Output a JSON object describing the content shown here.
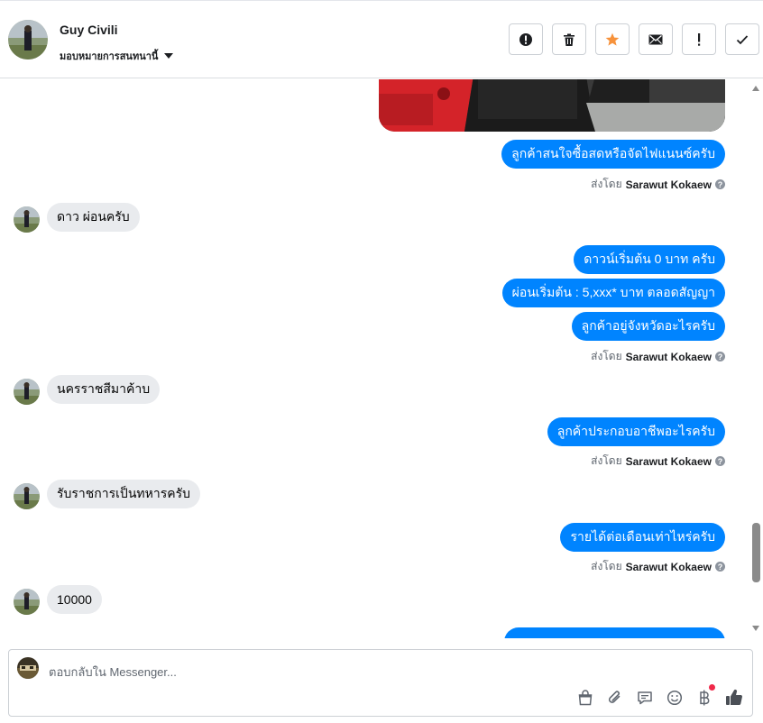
{
  "header": {
    "name": "Guy Civili",
    "assign_label": "มอบหมายการสนทนานี้",
    "actions": [
      {
        "icon": "alert-circle-icon",
        "name": "mark-spam-button"
      },
      {
        "icon": "trash-icon",
        "name": "delete-button"
      },
      {
        "icon": "star-icon",
        "name": "star-button"
      },
      {
        "icon": "envelope-icon",
        "name": "mark-unread-button"
      },
      {
        "icon": "exclamation-icon",
        "name": "follow-up-button"
      },
      {
        "icon": "checkmark-icon",
        "name": "done-button"
      }
    ],
    "star_color": "#f7923b"
  },
  "thread": {
    "sender_prefix": "ส่งโดย",
    "agent_name": "Sarawut Kokaew",
    "help_glyph": "?",
    "messages": [
      {
        "id": "m1",
        "dir": "out",
        "text": "ลูกค้าสนใจซื้อสดหรือจัดไฟแนนซ์ครับ"
      },
      {
        "id": "m2",
        "dir": "in",
        "text": "ดาว ผ่อนครับ"
      },
      {
        "id": "m3",
        "dir": "out",
        "text": "ดาวน์เริ่มต้น 0 บาท ครับ"
      },
      {
        "id": "m4",
        "dir": "out",
        "text": "ผ่อนเริ่มต้น : 5,xxx* บาท ตลอดสัญญา"
      },
      {
        "id": "m5",
        "dir": "out",
        "text": "ลูกค้าอยู่จังหวัดอะไรครับ"
      },
      {
        "id": "m6",
        "dir": "in",
        "text": "นครราชสีมาค้าบ"
      },
      {
        "id": "m7",
        "dir": "out",
        "text": "ลูกค้าประกอบอาชีพอะไรครับ"
      },
      {
        "id": "m8",
        "dir": "in",
        "text": "รับราชการเป็นทหารครับ"
      },
      {
        "id": "m9",
        "dir": "out",
        "text": "รายได้ต่อเดือนเท่าไหร่ครับ"
      },
      {
        "id": "m10",
        "dir": "in",
        "text": "10000"
      }
    ],
    "accent_color": "#0084ff",
    "incoming_color": "#e9ebee"
  },
  "composer": {
    "placeholder": "ตอบกลับใน Messenger...",
    "tools": [
      "shopping-bag-icon",
      "paperclip-icon",
      "quick-reply-icon",
      "emoji-icon",
      "baht-icon",
      "thumbs-up-icon"
    ]
  }
}
